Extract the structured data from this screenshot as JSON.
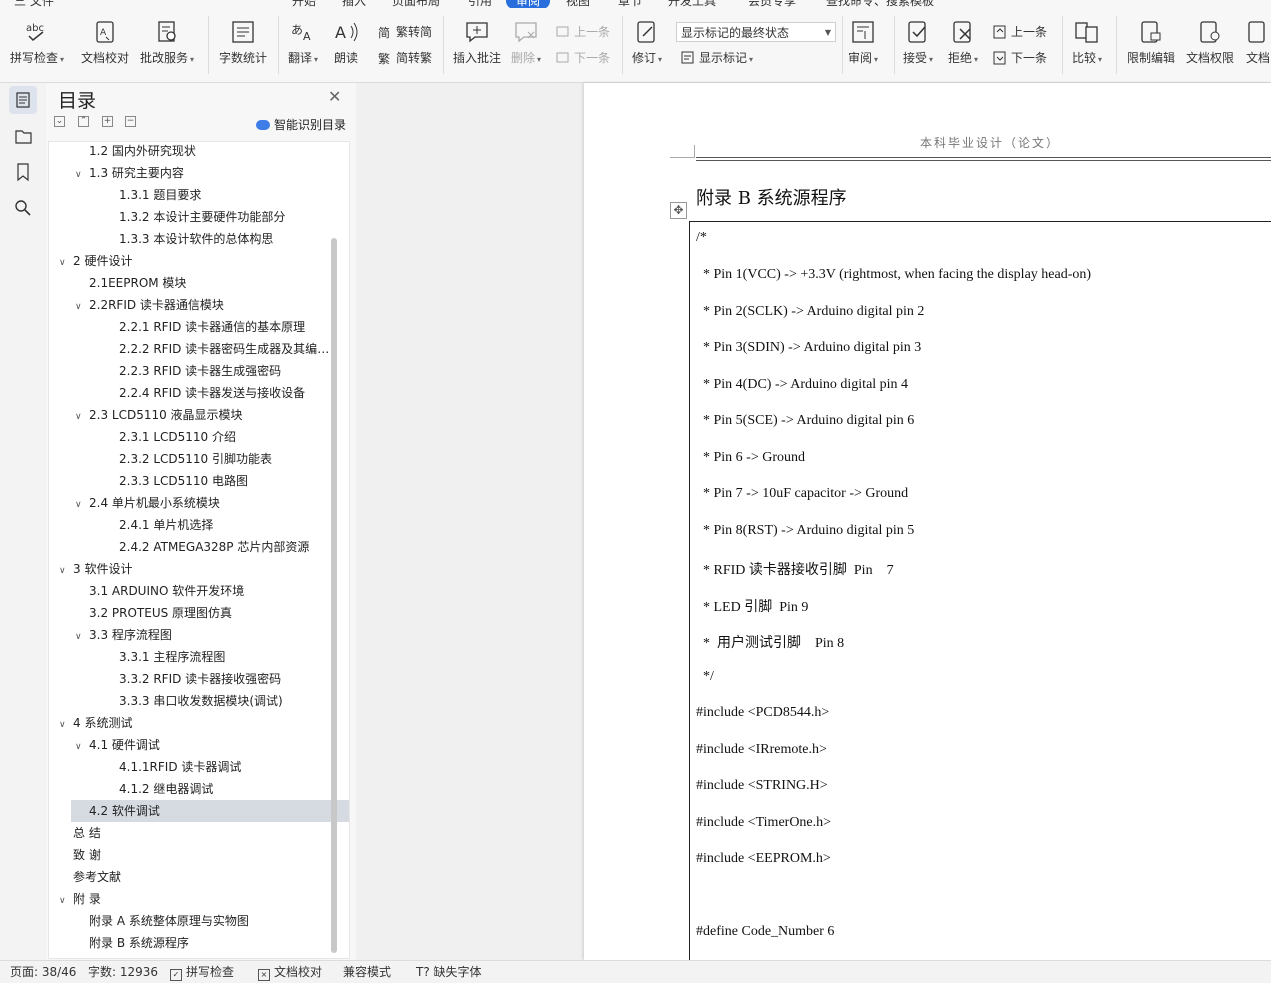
{
  "menu_tabs": [
    "三 文件",
    "开始",
    "插入",
    "页面布局",
    "引用",
    "审阅",
    "视图",
    "章节",
    "开发工具",
    "会员专享",
    "查找命令、搜索模板"
  ],
  "ribbon": {
    "spell_check": "拼写检查",
    "doc_proof": "文档校对",
    "batch_service": "批改服务",
    "word_count": "字数统计",
    "translate": "翻译",
    "read_aloud": "朗读",
    "trad_to_simp": "繁转简",
    "simp_to_trad": "简转繁",
    "insert_comment": "插入批注",
    "delete": "删除",
    "prev_comment": "上一条",
    "next_comment": "下一条",
    "track_changes": "修订",
    "markup_state": "显示标记的最终状态",
    "show_markup": "显示标记",
    "review": "审阅",
    "accept": "接受",
    "reject": "拒绝",
    "prev_change": "上一条",
    "next_change": "下一条",
    "compare": "比较",
    "restrict_edit": "限制编辑",
    "doc_permission": "文档权限",
    "doc_more": "文档"
  },
  "toc": {
    "title": "目录",
    "smart_label": "智能识别目录",
    "items": [
      {
        "text": "1.2 国内外研究现状",
        "level": 2,
        "toggle": ""
      },
      {
        "text": "1.3 研究主要内容",
        "level": 2,
        "toggle": "∨"
      },
      {
        "text": "1.3.1 题目要求",
        "level": 3,
        "toggle": ""
      },
      {
        "text": "1.3.2 本设计主要硬件功能部分",
        "level": 3,
        "toggle": ""
      },
      {
        "text": "1.3.3 本设计软件的总体构思",
        "level": 3,
        "toggle": ""
      },
      {
        "text": "2 硬件设计",
        "level": 1,
        "toggle": "∨"
      },
      {
        "text": "2.1EEPROM 模块",
        "level": 2,
        "toggle": ""
      },
      {
        "text": "2.2RFID 读卡器通信模块",
        "level": 2,
        "toggle": "∨"
      },
      {
        "text": "2.2.1 RFID 读卡器通信的基本原理",
        "level": 3,
        "toggle": ""
      },
      {
        "text": "2.2.2 RFID 读卡器密码生成器及其编 ...",
        "level": 3,
        "toggle": ""
      },
      {
        "text": "2.2.3 RFID 读卡器生成强密码",
        "level": 3,
        "toggle": ""
      },
      {
        "text": "2.2.4 RFID 读卡器发送与接收设备",
        "level": 3,
        "toggle": ""
      },
      {
        "text": "2.3 LCD5110 液晶显示模块",
        "level": 2,
        "toggle": "∨"
      },
      {
        "text": "2.3.1 LCD5110 介绍",
        "level": 3,
        "toggle": ""
      },
      {
        "text": "2.3.2 LCD5110 引脚功能表",
        "level": 3,
        "toggle": ""
      },
      {
        "text": "2.3.3 LCD5110 电路图",
        "level": 3,
        "toggle": ""
      },
      {
        "text": "2.4  单片机最小系统模块",
        "level": 2,
        "toggle": "∨"
      },
      {
        "text": "2.4.1 单片机选择",
        "level": 3,
        "toggle": ""
      },
      {
        "text": "2.4.2 ATMEGA328P 芯片内部资源",
        "level": 3,
        "toggle": ""
      },
      {
        "text": "3 软件设计",
        "level": 1,
        "toggle": "∨"
      },
      {
        "text": "3.1 ARDUINO 软件开发环境",
        "level": 2,
        "toggle": ""
      },
      {
        "text": "3.2 PROTEUS 原理图仿真",
        "level": 2,
        "toggle": ""
      },
      {
        "text": "3.3  程序流程图",
        "level": 2,
        "toggle": "∨"
      },
      {
        "text": "3.3.1  主程序流程图",
        "level": 3,
        "toggle": ""
      },
      {
        "text": "3.3.2 RFID 读卡器接收强密码",
        "level": 3,
        "toggle": ""
      },
      {
        "text": "3.3.3  串口收发数据模块(调试)",
        "level": 3,
        "toggle": ""
      },
      {
        "text": "4 系统测试",
        "level": 1,
        "toggle": "∨"
      },
      {
        "text": "4.1  硬件调试",
        "level": 2,
        "toggle": "∨"
      },
      {
        "text": "4.1.1RFID 读卡器调试",
        "level": 3,
        "toggle": ""
      },
      {
        "text": "4.1.2 继电器调试",
        "level": 3,
        "toggle": ""
      },
      {
        "text": "4.2 软件调试",
        "level": 2,
        "toggle": "",
        "selected": true
      },
      {
        "text": "总   结",
        "level": 1,
        "toggle": ""
      },
      {
        "text": "致   谢",
        "level": 1,
        "toggle": ""
      },
      {
        "text": "参考文献",
        "level": 1,
        "toggle": ""
      },
      {
        "text": "附   录",
        "level": 1,
        "toggle": "∨"
      },
      {
        "text": "附录 A    系统整体原理与实物图",
        "level": 2,
        "toggle": ""
      },
      {
        "text": "附录 B    系统源程序",
        "level": 2,
        "toggle": ""
      }
    ]
  },
  "document": {
    "header": "本科毕业设计（论文）",
    "heading": "附录 B   系统源程序",
    "code_lines": [
      "/*",
      "  * Pin 1(VCC) -> +3.3V (rightmost, when facing the display head-on)",
      "  * Pin 2(SCLK) -> Arduino digital pin 2",
      "  * Pin 3(SDIN) -> Arduino digital pin 3",
      "  * Pin 4(DC) -> Arduino digital pin 4",
      "  * Pin 5(SCE) -> Arduino digital pin 6",
      "  * Pin 6 -> Ground",
      "  * Pin 7 -> 10uF capacitor -> Ground",
      "  * Pin 8(RST) -> Arduino digital pin 5",
      "  * RFID 读卡器接收引脚  Pin    7",
      "  * LED 引脚  Pin 9",
      "  *  用户测试引脚    Pin 8",
      "  */",
      "#include <PCD8544.h>",
      "#include <IRremote.h>",
      "#include <STRING.H>",
      "#include <TimerOne.h>",
      "#include <EEPROM.h>",
      "",
      "#define Code_Number 6"
    ]
  },
  "status": {
    "page": "页面: 38/46",
    "words": "字数: 12936",
    "spell": "拼写检查",
    "proof": "文档校对",
    "compat": "兼容模式",
    "missing_font": "缺失字体"
  }
}
